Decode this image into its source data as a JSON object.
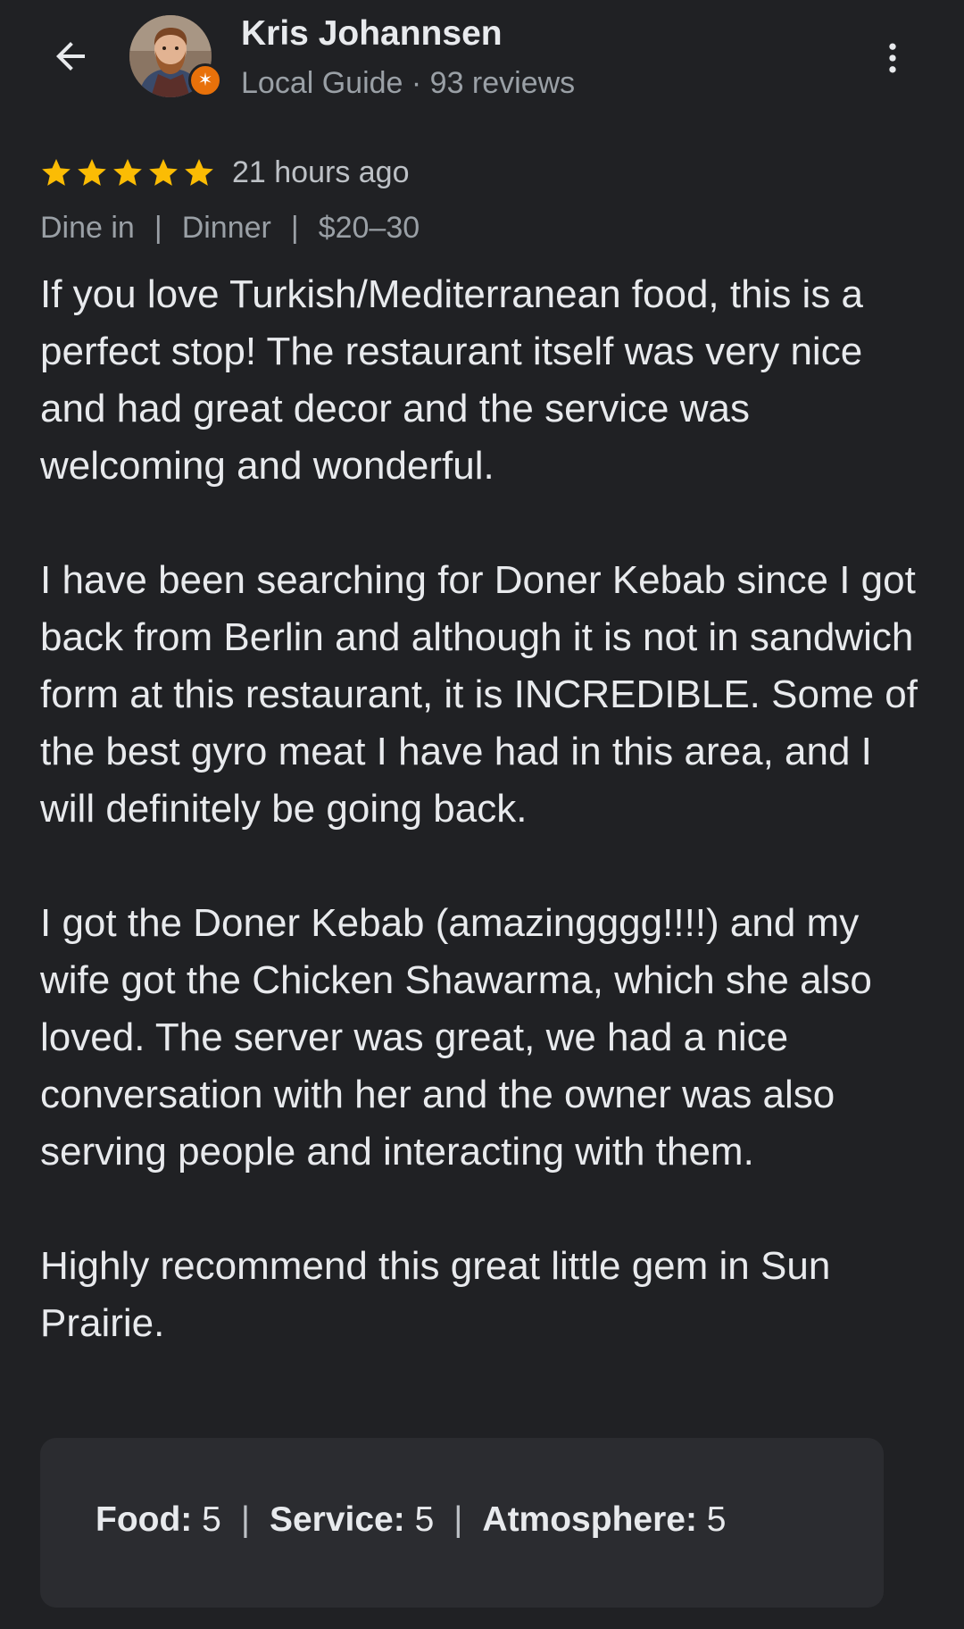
{
  "header": {
    "back_icon": "arrow-back-icon",
    "reviewer_name": "Kris Johannsen",
    "reviewer_meta": "Local Guide · 93 reviews",
    "badge_icon": "local-guide-star-icon",
    "more_icon": "more-vert-icon"
  },
  "review": {
    "rating": 5,
    "max_rating": 5,
    "star_color": "#fbbc04",
    "time_ago": "21 hours ago",
    "tags": [
      "Dine in",
      "Dinner",
      "$20–30"
    ],
    "tag_separator": "|",
    "paragraphs": [
      "If you love Turkish/Mediterranean food, this is a perfect stop!  The restaurant itself was very nice and had great decor and the service was welcoming and wonderful.",
      "I have been searching for Doner Kebab since I got back from Berlin and although it is not in sandwich form at this restaurant, it is INCREDIBLE.  Some of the best gyro meat I have had in this area, and I will definitely be going back.",
      "I got the Doner Kebab (amazingggg!!!!) and my wife got the Chicken Shawarma, which she also loved.  The server was great, we had a nice conversation with her and the owner was also serving people and interacting with them.",
      "Highly recommend this great little gem in Sun Prairie."
    ]
  },
  "subratings": {
    "separator": "|",
    "items": [
      {
        "label": "Food:",
        "value": "5"
      },
      {
        "label": "Service:",
        "value": "5"
      },
      {
        "label": "Atmosphere:",
        "value": "5"
      }
    ]
  },
  "colors": {
    "background": "#202124",
    "card": "#2b2c30",
    "text_primary": "#e8eaed",
    "text_secondary": "#9aa0a6",
    "badge": "#e8710a"
  }
}
